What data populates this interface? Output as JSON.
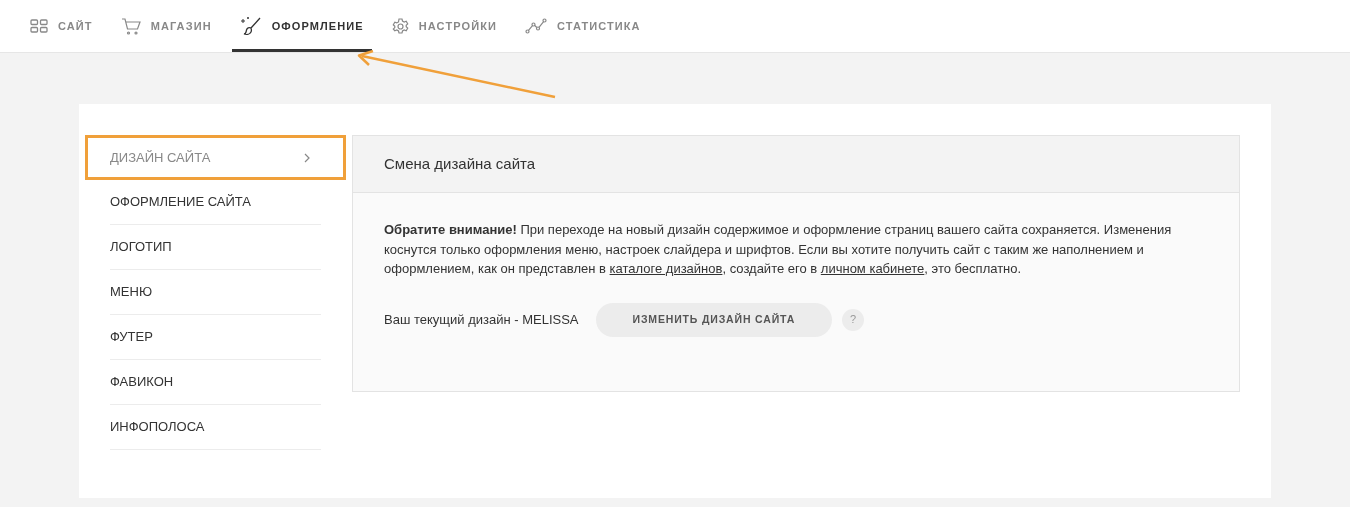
{
  "tabs": [
    {
      "label": "САЙТ",
      "selected": false
    },
    {
      "label": "МАГАЗИН",
      "selected": false
    },
    {
      "label": "ОФОРМЛЕНИЕ",
      "selected": true
    },
    {
      "label": "НАСТРОЙКИ",
      "selected": false
    },
    {
      "label": "СТАТИСТИКА",
      "selected": false
    }
  ],
  "annotations": [
    {
      "kind": "arrow"
    }
  ],
  "sidebar": {
    "items": [
      {
        "label": "ДИЗАЙН САЙТА",
        "selected": true,
        "highlighted": true
      },
      {
        "label": "ОФОРМЛЕНИЕ САЙТА",
        "selected": false,
        "highlighted": false
      },
      {
        "label": "ЛОГОТИП",
        "selected": false,
        "highlighted": false
      },
      {
        "label": "МЕНЮ",
        "selected": false,
        "highlighted": false
      },
      {
        "label": "ФУТЕР",
        "selected": false,
        "highlighted": false
      },
      {
        "label": "ФАВИКОН",
        "selected": false,
        "highlighted": false
      },
      {
        "label": "ИНФОПОЛОСА",
        "selected": false,
        "highlighted": false
      }
    ]
  },
  "panel": {
    "title": "Смена дизайна сайта",
    "notice": [
      {
        "kind": "text",
        "text": "**Обратите внимание!** При переходе на новый дизайн содержимое и оформление страниц вашего сайта сохраняется. Изменения коснутся только оформления меню, настроек слайдера и шрифтов. Если вы хотите получить сайт с таким же наполнением и оформлением, как он представлен в "
      },
      {
        "kind": "link",
        "text": "каталоге дизайнов"
      },
      {
        "kind": "text",
        "text": ", создайте его в "
      },
      {
        "kind": "link",
        "text": "личном кабинете"
      },
      {
        "kind": "text",
        "text": ", это бесплатно."
      }
    ],
    "current_design": "Ваш текущий дизайн - MELISSA",
    "button": "ИЗМЕНИТЬ ДИЗАЙН САЙТА",
    "help": "?"
  }
}
